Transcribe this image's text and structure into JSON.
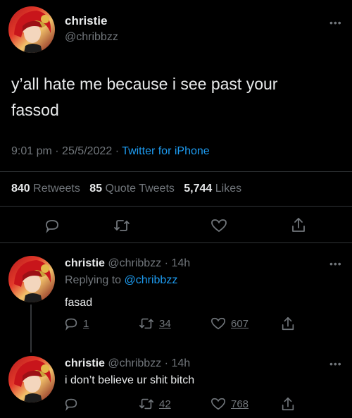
{
  "main_tweet": {
    "display_name": "christie",
    "handle": "@chribbzz",
    "text_line1": "y’all hate me because i see past your",
    "text_line2": "fassod",
    "time": "9:01 pm",
    "sep1": "·",
    "date": "25/5/2022",
    "sep2": "·",
    "source": "Twitter for iPhone",
    "stats": {
      "retweets_count": "840",
      "retweets_label": "Retweets",
      "quotes_count": "85",
      "quotes_label": "Quote Tweets",
      "likes_count": "5,744",
      "likes_label": "Likes"
    },
    "actions": [
      "reply-icon",
      "retweet-icon",
      "like-icon",
      "share-icon"
    ],
    "more_icon": "more-icon"
  },
  "replies": [
    {
      "display_name": "christie",
      "handle": "@chribbzz",
      "sep": "·",
      "time": "14h",
      "replying_prefix": "Replying to",
      "replying_to": "@chribbzz",
      "text": "fasad",
      "reply_count": "1",
      "retweet_count": "34",
      "like_count": "607"
    },
    {
      "display_name": "christie",
      "handle": "@chribbzz",
      "sep": "·",
      "time": "14h",
      "text": "i don’t believe ur shit bitch",
      "reply_count": "",
      "retweet_count": "42",
      "like_count": "768"
    }
  ],
  "colors": {
    "background": "#000000",
    "text": "#e7e9ea",
    "muted": "#71767b",
    "link": "#1d9bf0",
    "divider": "#2f3336"
  }
}
